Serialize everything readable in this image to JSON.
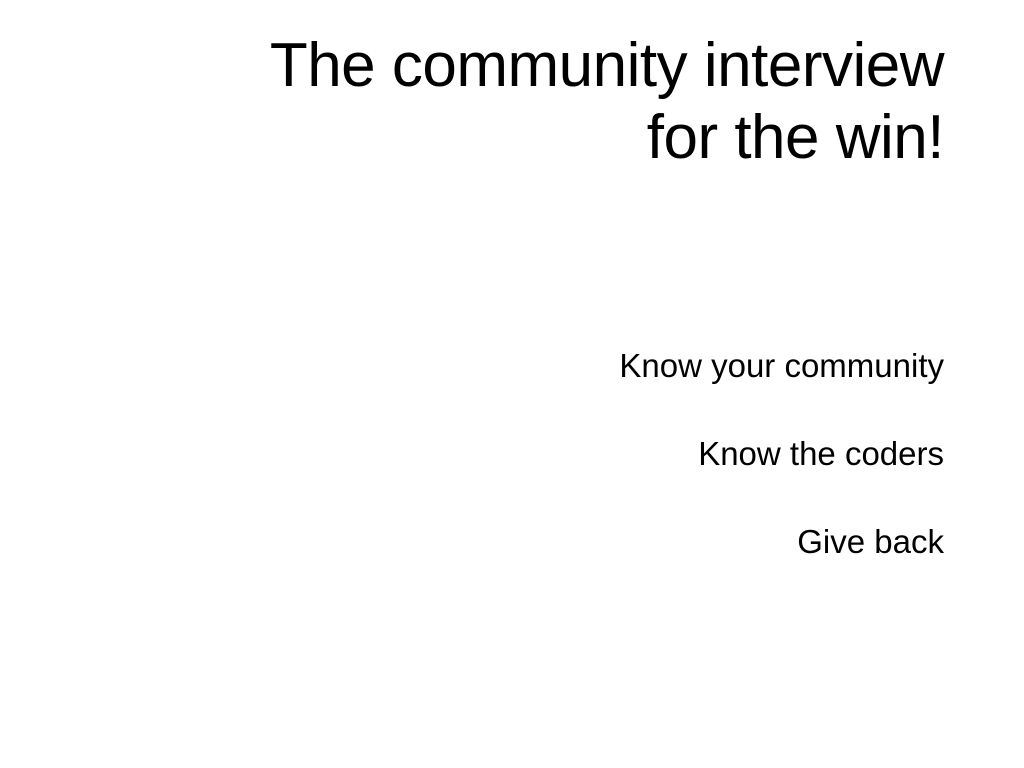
{
  "slide": {
    "title_lines": [
      "The community interview",
      "for the win!"
    ],
    "bullets": [
      "Know your community",
      "Know the coders",
      "Give back"
    ]
  }
}
